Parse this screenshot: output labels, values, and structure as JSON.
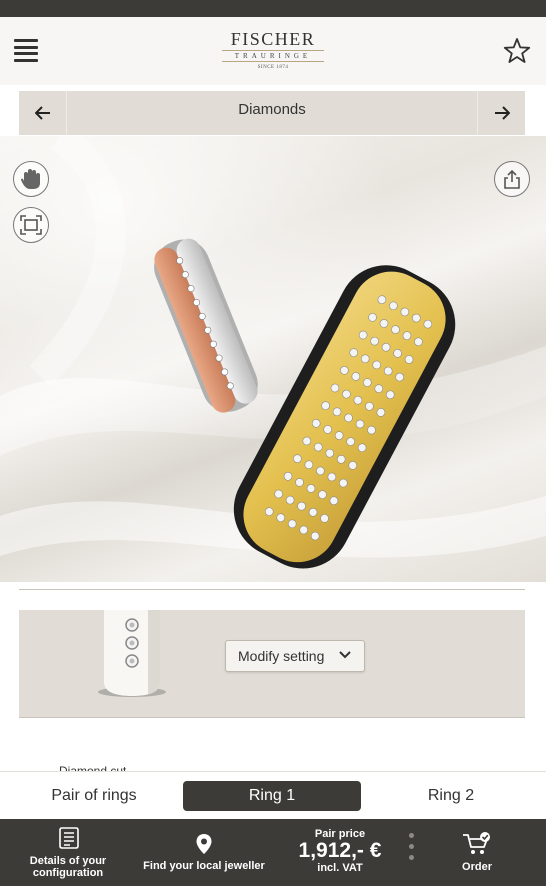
{
  "header": {
    "brand": "FISCHER",
    "brand_sub": "TRAURINGE",
    "since": "SINCE 1874",
    "menu_icon": "hamburger-menu-icon",
    "favorite_icon": "star-outline-icon"
  },
  "nav": {
    "title": "Diamonds",
    "prev_icon": "arrow-left-icon",
    "next_icon": "arrow-right-icon"
  },
  "viewer": {
    "hand_icon": "hand-icon",
    "fit_icon": "fit-screen-icon",
    "share_icon": "share-icon"
  },
  "setting": {
    "modify_label": "Modify setting",
    "chevron_icon": "chevron-down-icon"
  },
  "cut_label": "Diamond cut",
  "tabs": [
    {
      "label": "Pair of rings"
    },
    {
      "label": "Ring 1"
    },
    {
      "label": "Ring 2"
    }
  ],
  "bottom": {
    "details": "Details of your configuration",
    "jeweller": "Find your local jeweller",
    "pair_price_label": "Pair price",
    "pair_price": "1,912,- €",
    "vat": "incl. VAT",
    "order": "Order"
  },
  "colors": {
    "dark": "#3d3b37",
    "panel": "#e1ddd6",
    "gold": "#e3c04e",
    "rose": "#d9906d"
  }
}
